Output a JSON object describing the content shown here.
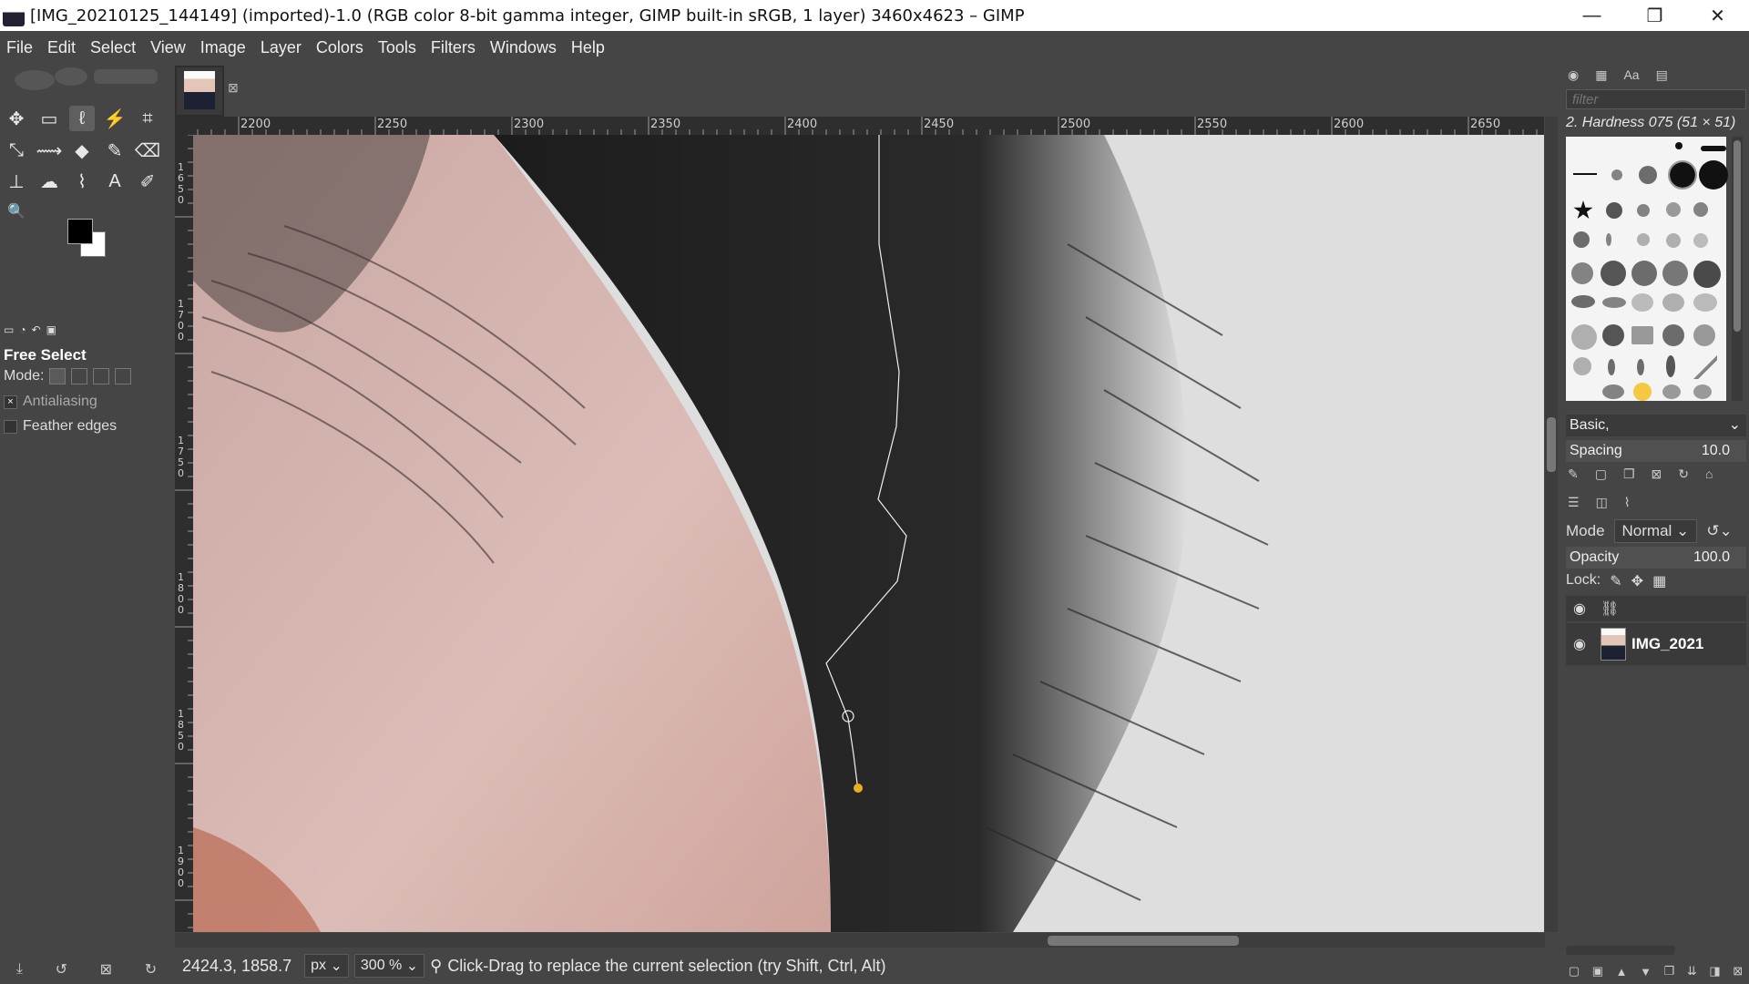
{
  "window": {
    "title": "[IMG_20210125_144149] (imported)-1.0 (RGB color 8-bit gamma integer, GIMP built-in sRGB, 1 layer) 3460x4623 – GIMP",
    "minimize": "—",
    "restore": "❐",
    "close": "✕"
  },
  "menu": [
    "File",
    "Edit",
    "Select",
    "View",
    "Image",
    "Layer",
    "Colors",
    "Tools",
    "Filters",
    "Windows",
    "Help"
  ],
  "toolbox": {
    "tools": [
      {
        "name": "move-tool-icon",
        "glyph": "✥"
      },
      {
        "name": "rect-select-icon",
        "glyph": "▭"
      },
      {
        "name": "free-select-icon",
        "glyph": "ℓ"
      },
      {
        "name": "fuzzy-select-icon",
        "glyph": "⚡"
      },
      {
        "name": "crop-icon",
        "glyph": "⌗"
      },
      {
        "name": "transform-icon",
        "glyph": "⤡"
      },
      {
        "name": "warp-icon",
        "glyph": "⟿"
      },
      {
        "name": "bucket-fill-icon",
        "glyph": "◆"
      },
      {
        "name": "paintbrush-icon",
        "glyph": "✎"
      },
      {
        "name": "eraser-icon",
        "glyph": "⌫"
      },
      {
        "name": "clone-icon",
        "glyph": "⊥"
      },
      {
        "name": "smudge-icon",
        "glyph": "☁"
      },
      {
        "name": "paths-icon",
        "glyph": "⌇"
      },
      {
        "name": "text-tool-icon",
        "glyph": "A"
      },
      {
        "name": "color-picker-icon",
        "glyph": "✐"
      },
      {
        "name": "zoom-icon",
        "glyph": "🔍"
      }
    ],
    "tool_options": {
      "title": "Free Select",
      "mode_label": "Mode:",
      "antialiasing": "Antialiasing",
      "antialiasing_checked": "×",
      "feather": "Feather edges"
    }
  },
  "rulers": {
    "horizontal": [
      "2200",
      "2250",
      "2300",
      "2350",
      "2400",
      "2450",
      "2500",
      "2550",
      "2600",
      "2650"
    ],
    "vertical": [
      "1650",
      "1700",
      "1750",
      "1800",
      "1850",
      "1900"
    ]
  },
  "status": {
    "coords": "2424.3, 1858.7",
    "unit": "px",
    "zoom": "300 %",
    "message": "Click-Drag to replace the current selection (try Shift, Ctrl, Alt)"
  },
  "dock": {
    "filter_placeholder": "filter",
    "brush_name": "2. Hardness 075 (51 × 51)",
    "brush_set": "Basic,",
    "spacing_label": "Spacing",
    "spacing_value": "10.0",
    "mode_label": "Mode",
    "mode_value": "Normal",
    "opacity_label": "Opacity",
    "opacity_value": "100.0",
    "lock_label": "Lock:",
    "layer_name": "IMG_2021"
  },
  "colors": {
    "background": "#454545",
    "selection_handle": "#e8b020"
  }
}
